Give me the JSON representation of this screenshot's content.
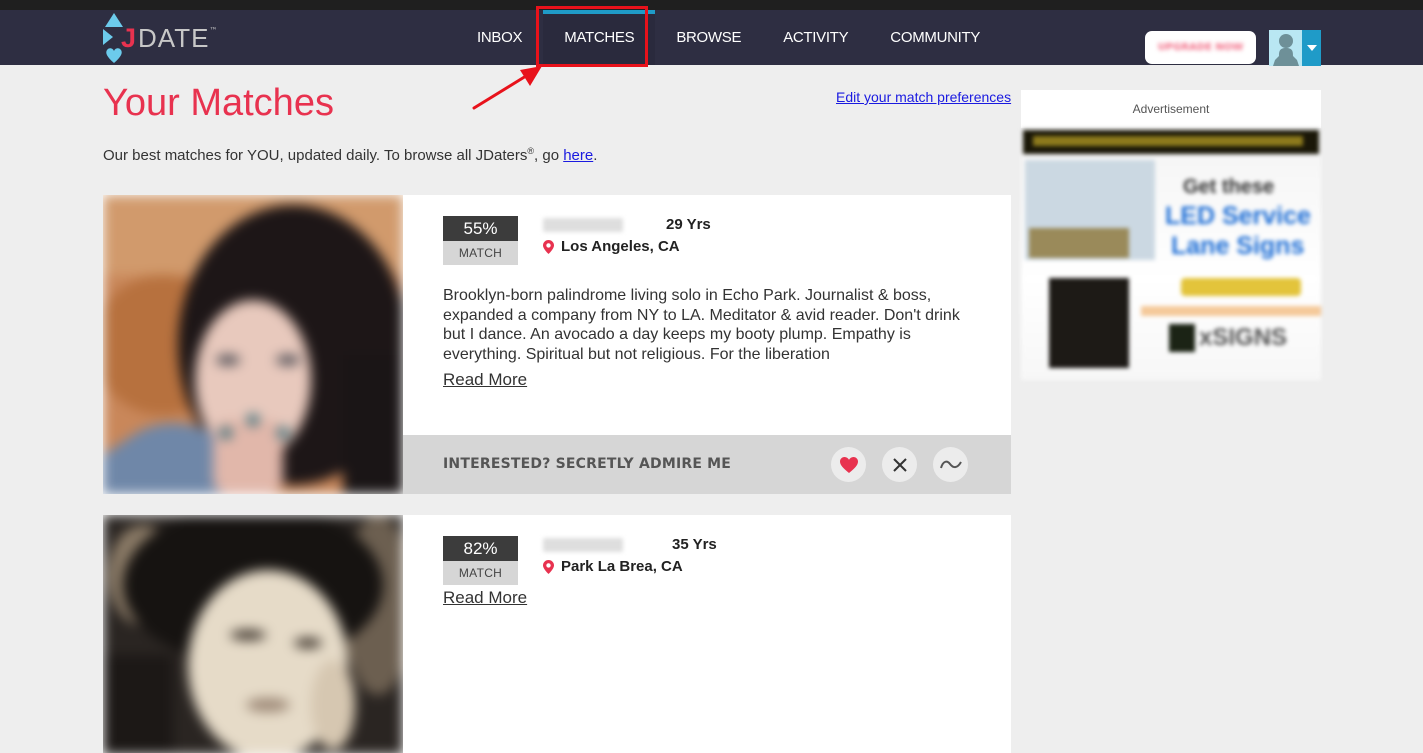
{
  "brand": {
    "logo_text": "JDATE",
    "trademark": "™"
  },
  "nav": {
    "items": [
      {
        "label": "INBOX",
        "active": false
      },
      {
        "label": "MATCHES",
        "active": true
      },
      {
        "label": "BROWSE",
        "active": false
      },
      {
        "label": "ACTIVITY",
        "active": false
      },
      {
        "label": "COMMUNITY",
        "active": false
      }
    ],
    "upgrade_label": "UPGRADE NOW",
    "accent_color": "#1f9bc8"
  },
  "page": {
    "title": "Your Matches",
    "edit_preferences_link": "Edit your match preferences",
    "subtitle_prefix": "Our best matches for YOU, updated daily. To browse all JDaters",
    "subtitle_reg": "®",
    "subtitle_mid": ", go ",
    "subtitle_link": "here",
    "subtitle_suffix": ".",
    "title_color": "#e8324f"
  },
  "matches": [
    {
      "match_percent": "55%",
      "match_label": "MATCH",
      "age": "29 Yrs",
      "location": "Los Angeles, CA",
      "bio": "Brooklyn-born palindrome living solo in Echo Park. Journalist & boss, expanded a company from NY to LA. Meditator & avid reader. Don't drink but I dance. An avocado a day keeps my booty plump. Empathy is everything. Spiritual but not religious. For the liberation",
      "read_more": "Read More",
      "action_label": "INTERESTED? SECRETLY ADMIRE ME",
      "actions": [
        "heart-icon",
        "close-icon",
        "tilde-icon"
      ]
    },
    {
      "match_percent": "82%",
      "match_label": "MATCH",
      "age": "35 Yrs",
      "location": "Park La Brea, CA",
      "read_more": "Read More"
    }
  ],
  "ad": {
    "label": "Advertisement",
    "headline_1": "Get these",
    "headline_2": "LED Service",
    "headline_3": "Lane Signs",
    "brand": "xSIGNS"
  }
}
